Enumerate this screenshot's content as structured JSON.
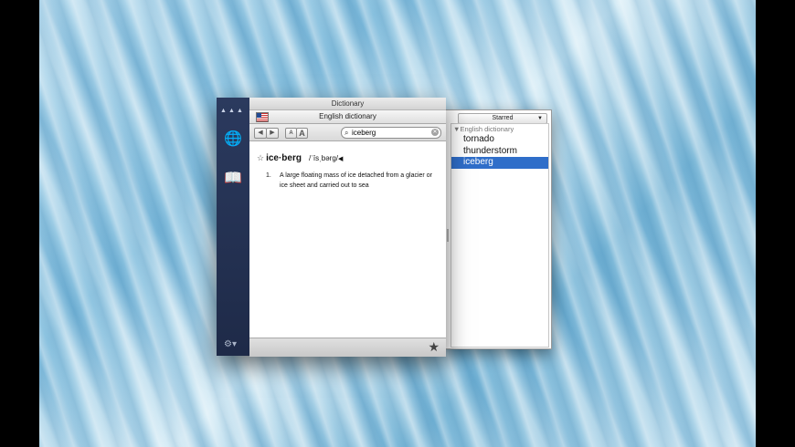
{
  "window": {
    "title": "Dictionary"
  },
  "dictionary_selector": {
    "label": "English dictionary"
  },
  "toolbar": {
    "back_label": "◀",
    "forward_label": "▶",
    "font_smaller_label": "A",
    "font_larger_label": "A",
    "search_value": "iceberg"
  },
  "entry": {
    "headword": "ice·berg",
    "pronunciation": "/ˈīsˌbərg/",
    "definitions": [
      {
        "number": "1.",
        "text": "A large floating mass of ice detached from a glacier or ice sheet and carried out to sea"
      }
    ]
  },
  "starred_panel": {
    "selector_label": "Starred",
    "group_label": "English dictionary",
    "items": [
      "tornado",
      "thunderstorm",
      "iceberg"
    ],
    "selected_index": 2
  },
  "colors": {
    "selection": "#2f6ec9",
    "sidebar": "#25324f"
  }
}
